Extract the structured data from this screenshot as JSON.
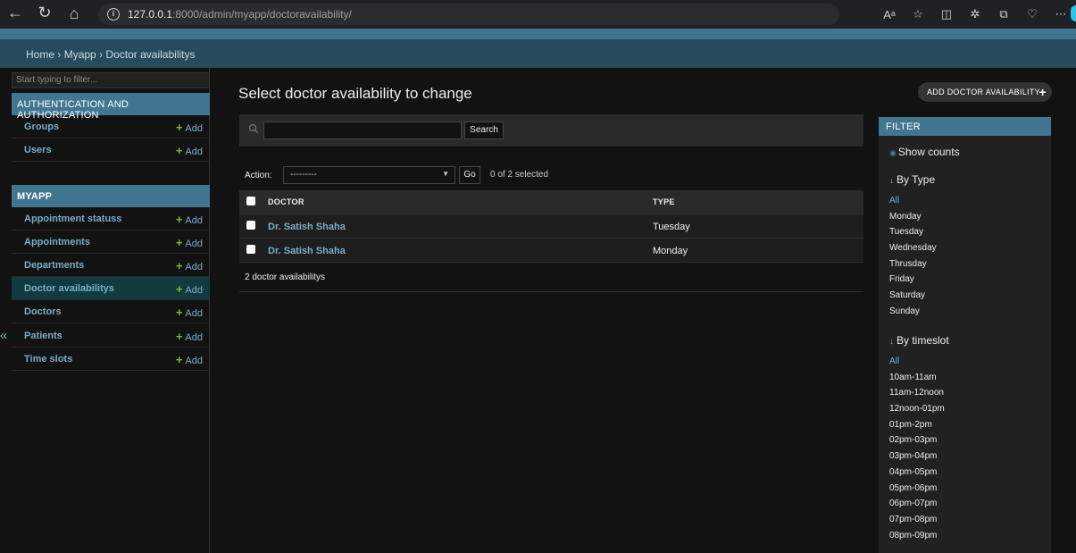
{
  "browser": {
    "url_host": "127.0.0.1",
    "url_rest": ":8000/admin/myapp/doctoravailability/"
  },
  "breadcrumbs": [
    "Home",
    "Myapp",
    "Doctor availabilitys"
  ],
  "breadcrumb_separator": "›",
  "sidebar": {
    "filter_placeholder": "Start typing to filter...",
    "auth_caption": "AUTHENTICATION AND AUTHORIZATION",
    "auth_items": [
      {
        "label": "Groups",
        "add": "Add"
      },
      {
        "label": "Users",
        "add": "Add"
      }
    ],
    "app_caption": "MYAPP",
    "app_items": [
      {
        "label": "Appointment statuss",
        "add": "Add"
      },
      {
        "label": "Appointments",
        "add": "Add"
      },
      {
        "label": "Departments",
        "add": "Add"
      },
      {
        "label": "Doctor availabilitys",
        "add": "Add",
        "current": true
      },
      {
        "label": "Doctors",
        "add": "Add"
      },
      {
        "label": "Patients",
        "add": "Add"
      },
      {
        "label": "Time slots",
        "add": "Add"
      }
    ],
    "collapse_glyph": "«"
  },
  "main": {
    "title": "Select doctor availability to change",
    "add_button": "ADD DOCTOR AVAILABILITY",
    "search_button": "Search",
    "search_value": "",
    "action_label": "Action:",
    "action_selected": "---------",
    "go_button": "Go",
    "selected_count": "0 of 2 selected",
    "table": {
      "headers": [
        "DOCTOR",
        "TYPE"
      ],
      "rows": [
        [
          "Dr. Satish Shaha",
          "Tuesday"
        ],
        [
          "Dr. Satish Shaha",
          "Monday"
        ]
      ]
    },
    "paginator": "2 doctor availabilitys"
  },
  "filter": {
    "title": "FILTER",
    "show_counts": "Show counts",
    "by_type": {
      "heading": "By Type",
      "options": [
        "All",
        "Monday",
        "Tuesday",
        "Wednesday",
        "Thrusday",
        "Friday",
        "Saturday",
        "Sunday"
      ]
    },
    "by_timeslot": {
      "heading": "By timeslot",
      "options": [
        "All",
        "10am-11am",
        "11am-12noon",
        "12noon-01pm",
        "01pm-2pm",
        "02pm-03pm",
        "03pm-04pm",
        "04pm-05pm",
        "05pm-06pm",
        "06pm-07pm",
        "07pm-08pm",
        "08pm-09pm"
      ]
    }
  },
  "colors": {
    "header": "#417690",
    "breadcrumbs": "#264b5d",
    "link": "#79aec8",
    "add_plus": "#70bf2b",
    "current_row": "#123b40"
  }
}
